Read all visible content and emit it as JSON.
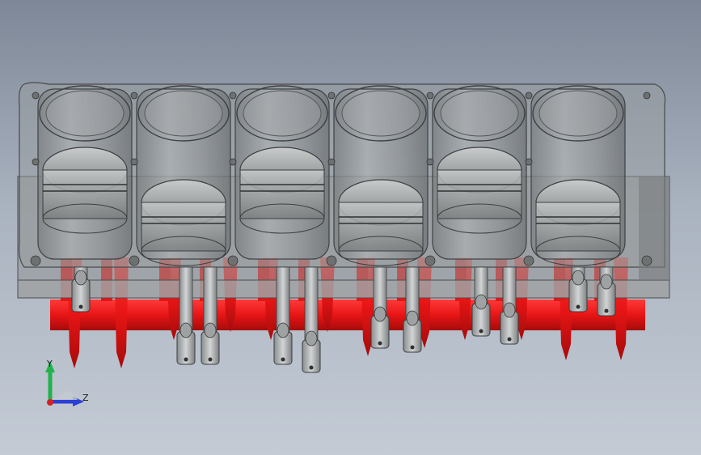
{
  "viewport": {
    "background_top": "#7d8797",
    "background_bottom": "#c4cbd5"
  },
  "model": {
    "name": "",
    "cylinders": 6,
    "block_color": "#9a9d9e",
    "crankshaft_color": "#e81515",
    "rod_color": "#b9bcbc"
  },
  "triad": {
    "y_label": "Y",
    "z_label": "Z",
    "y_color": "#22b24c",
    "z_color": "#2a3fd6",
    "x_color": "#d61f1f"
  }
}
